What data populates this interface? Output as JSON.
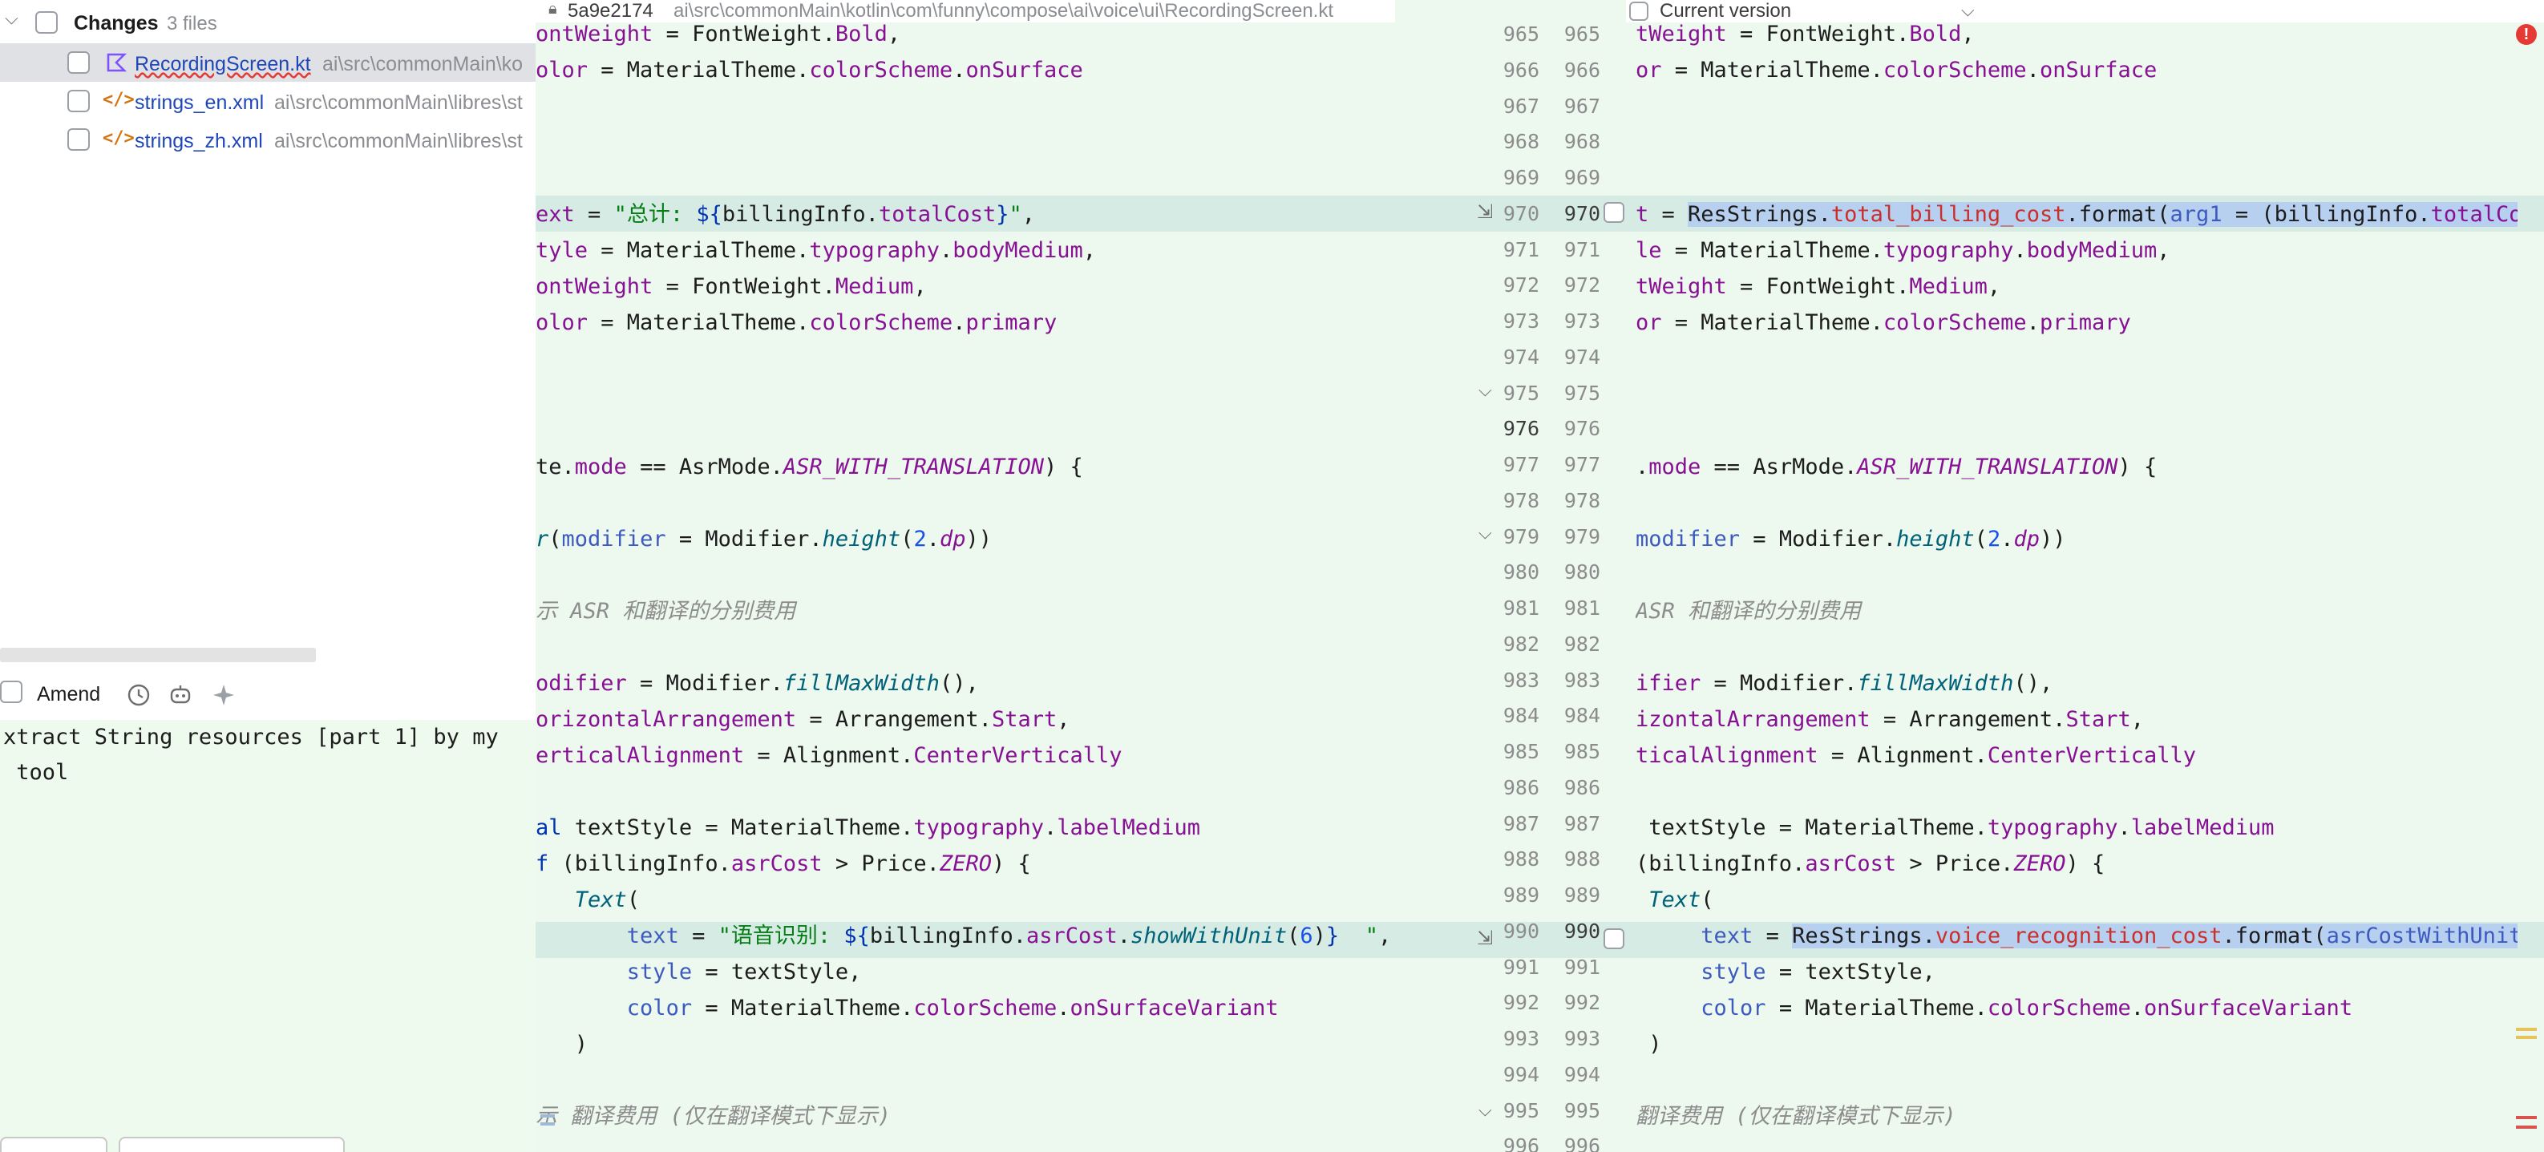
{
  "changes": {
    "label": "Changes",
    "count": "3 files",
    "files": [
      {
        "name": "RecordingScreen.kt",
        "path": "ai\\src\\commonMain\\ko",
        "icon": "kotlin-file-icon"
      },
      {
        "name": "strings_en.xml",
        "path": "ai\\src\\commonMain\\libres\\st",
        "icon": "xml-file-icon"
      },
      {
        "name": "strings_zh.xml",
        "path": "ai\\src\\commonMain\\libres\\st",
        "icon": "xml-file-icon"
      }
    ]
  },
  "commit": {
    "amend_label": "Amend",
    "message_line1": "xtract String resources [part 1] by my",
    "message_line2": " tool"
  },
  "diff": {
    "left_header_hash": "5a9e2174",
    "left_header_path": "ai\\src\\commonMain\\kotlin\\com\\funny\\compose\\ai\\voice\\ui\\RecordingScreen.kt",
    "right_header": "Current version",
    "left_numbers": [
      "965",
      "966",
      "967",
      "968",
      "969",
      "970",
      "971",
      "972",
      "973",
      "974",
      "975",
      "976",
      "977",
      "978",
      "979",
      "980",
      "981",
      "982",
      "983",
      "984",
      "985",
      "986",
      "987",
      "988",
      "989",
      "990",
      "991",
      "992",
      "993",
      "994",
      "995",
      "996"
    ],
    "right_numbers": [
      "965",
      "966",
      "967",
      "968",
      "969",
      "970",
      "971",
      "972",
      "973",
      "974",
      "975",
      "976",
      "977",
      "978",
      "979",
      "980",
      "981",
      "982",
      "983",
      "984",
      "985",
      "986",
      "987",
      "988",
      "989",
      "990",
      "991",
      "992",
      "993",
      "994",
      "995",
      "996"
    ],
    "changed_rows": [
      "970",
      "990"
    ],
    "error_count_badge": "!"
  },
  "colors": {
    "diff_background": "#edf8ee",
    "changed_row": "#d6ebe3",
    "commit_message_bg": "#edfaed",
    "error_red": "#e53935"
  }
}
